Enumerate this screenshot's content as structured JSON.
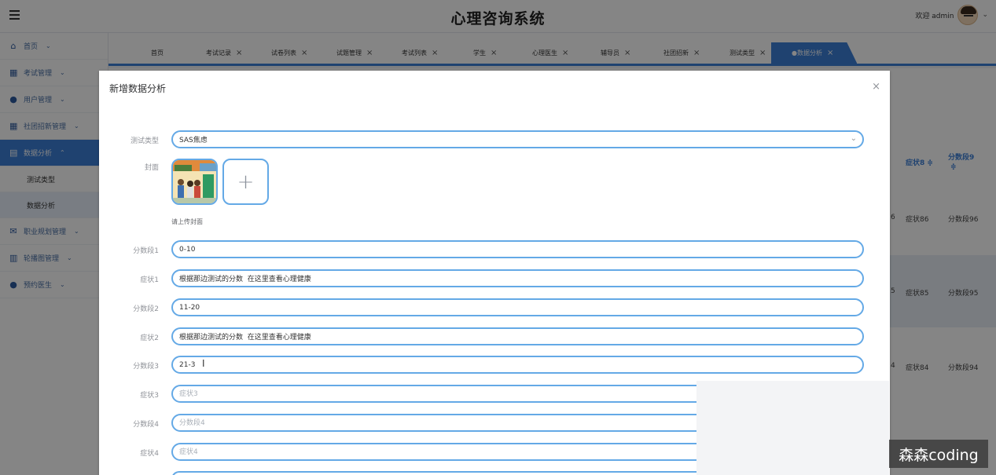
{
  "header": {
    "title": "心理咨询系统",
    "welcome": "欢迎 admin",
    "menu_icon": "hamburger-icon",
    "user_chevron": "⌄"
  },
  "sidebar": {
    "items": [
      {
        "label": "首页",
        "icon": "home-icon",
        "arrow": "⌄"
      },
      {
        "label": "考试管理",
        "icon": "grid-icon",
        "arrow": "⌄"
      },
      {
        "label": "用户管理",
        "icon": "user-icon",
        "arrow": "⌄"
      },
      {
        "label": "社团招新管理",
        "icon": "grid-icon",
        "arrow": "⌄"
      },
      {
        "label": "数据分析",
        "icon": "table-icon",
        "arrow": "⌃",
        "active": true
      },
      {
        "label": "职业规划管理",
        "icon": "mail-icon",
        "arrow": "⌄"
      },
      {
        "label": "轮播图管理",
        "icon": "columns-icon",
        "arrow": "⌄"
      },
      {
        "label": "预约医生",
        "icon": "user-icon",
        "arrow": "⌄"
      }
    ],
    "subitems": [
      {
        "label": "测试类型"
      },
      {
        "label": "数据分析"
      }
    ]
  },
  "tabs": [
    {
      "label": "首页",
      "closable": false
    },
    {
      "label": "考试记录",
      "closable": true
    },
    {
      "label": "试卷列表",
      "closable": true
    },
    {
      "label": "试题管理",
      "closable": true
    },
    {
      "label": "考试列表",
      "closable": true
    },
    {
      "label": "学生",
      "closable": true
    },
    {
      "label": "心理医生",
      "closable": true
    },
    {
      "label": "辅导员",
      "closable": true
    },
    {
      "label": "社团招新",
      "closable": true
    },
    {
      "label": "测试类型",
      "closable": true
    },
    {
      "label": "●数据分析",
      "closable": true,
      "active": true
    }
  ],
  "close_glyph": "×",
  "background_table": {
    "headers": [
      "症状8 ≑",
      "分数段9",
      "≑"
    ],
    "rows": [
      {
        "left": "6",
        "sym": "症状86",
        "score": "分数段96"
      },
      {
        "left": "5",
        "sym": "症状85",
        "score": "分数段95"
      },
      {
        "left": "4",
        "sym": "症状84",
        "score": "分数段94"
      }
    ]
  },
  "dialog": {
    "title": "新增数据分析",
    "close": "×",
    "fields": {
      "test_type": {
        "label": "测试类型",
        "value": "SAS焦虑",
        "arrow": "⌄"
      },
      "cover": {
        "label": "封面",
        "tip": "请上传封面",
        "add": "+"
      },
      "score1": {
        "label": "分数段1",
        "value": "0-10",
        "placeholder": "分数段1"
      },
      "symptom1": {
        "label": "症状1",
        "value": "根据那边测试的分数  在这里查看心理健康",
        "placeholder": "症状1"
      },
      "score2": {
        "label": "分数段2",
        "value": "11-20",
        "placeholder": "分数段2"
      },
      "symptom2": {
        "label": "症状2",
        "value": "根据那边测试的分数  在这里查看心理健康",
        "placeholder": "症状2"
      },
      "score3": {
        "label": "分数段3",
        "value": "21-3",
        "placeholder": "分数段3"
      },
      "symptom3": {
        "label": "症状3",
        "value": "",
        "placeholder": "症状3"
      },
      "score4": {
        "label": "分数段4",
        "value": "",
        "placeholder": "分数段4"
      },
      "symptom4": {
        "label": "症状4",
        "value": "",
        "placeholder": "症状4"
      }
    }
  },
  "watermark": "森森coding",
  "colors": {
    "primary": "#3d7fd6",
    "field_border": "#64a9e6",
    "overlay": "rgba(0,0,0,0.48)"
  }
}
